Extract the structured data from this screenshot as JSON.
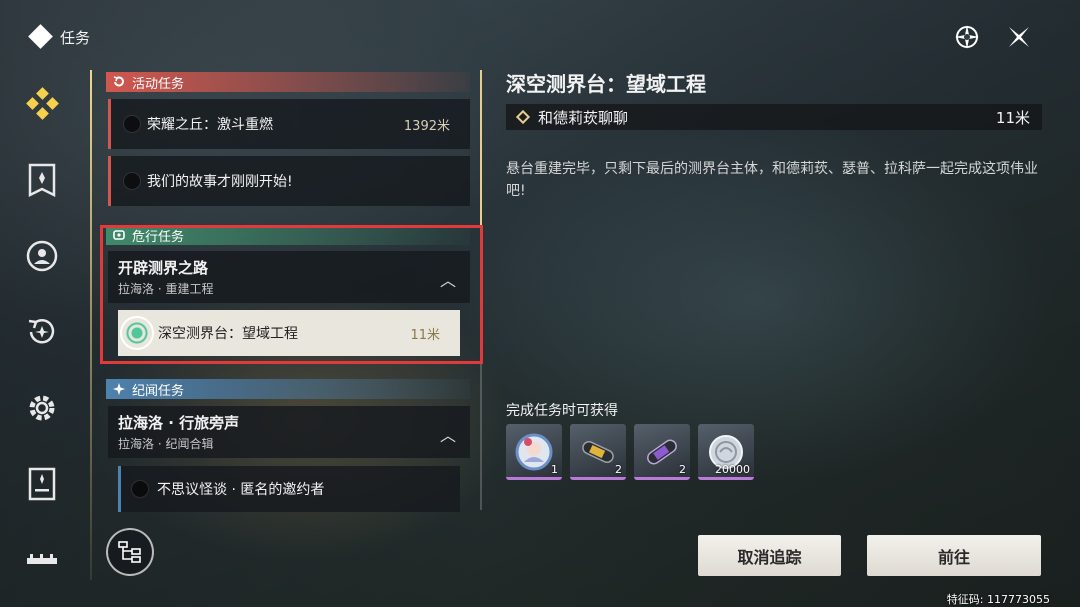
{
  "header": {
    "title": "任务",
    "icons": [
      "navigate-icon",
      "close-icon"
    ]
  },
  "nav": {
    "items": [
      "quests-icon",
      "bounty-icon",
      "character-icon",
      "history-icon",
      "settings-icon",
      "book-icon",
      "more-icon"
    ],
    "active": 0
  },
  "categories": {
    "event": {
      "label": "活动任务"
    },
    "danger": {
      "label": "危行任务"
    },
    "chronicle": {
      "label": "纪闻任务"
    }
  },
  "event_quests": [
    {
      "name": "荣耀之丘：激斗重燃",
      "distance": "1392米"
    },
    {
      "name": "我们的故事才刚刚开始!",
      "distance": ""
    }
  ],
  "danger_group": {
    "name": "开辟测界之路",
    "sub": "拉海洛 · 重建工程"
  },
  "danger_quest": {
    "name": "深空测界台：望域工程",
    "distance": "11米"
  },
  "chronicle_group": {
    "name": "拉海洛 · 行旅旁声",
    "sub": "拉海洛 · 纪闻合辑"
  },
  "chronicle_quest": {
    "name": "不思议怪谈 · 匿名的邀约者"
  },
  "detail": {
    "title": "深空测界台：望域工程",
    "objective": "和德莉莰聊聊",
    "objective_distance": "11米",
    "description": "悬台重建完毕，只剩下最后的测界台主体，和德莉莰、瑟普、拉科萨一起完成这项伟业吧!"
  },
  "rewards": {
    "title": "完成任务时可获得",
    "items": [
      {
        "icon": "character-token-icon",
        "qty": "1"
      },
      {
        "icon": "gold-capsule-icon",
        "qty": "2"
      },
      {
        "icon": "purple-capsule-icon",
        "qty": "2"
      },
      {
        "icon": "coin-icon",
        "qty": "20000"
      }
    ]
  },
  "buttons": {
    "cancel": "取消追踪",
    "go": "前往"
  },
  "uid": "特征码: 117773055",
  "colors": {
    "accent_gold": "#e6cf8a",
    "event_red": "#d2574e",
    "danger_green": "#3f8a6a",
    "chronicle_blue": "#4f82ae",
    "highlight": "#e23a3a"
  }
}
